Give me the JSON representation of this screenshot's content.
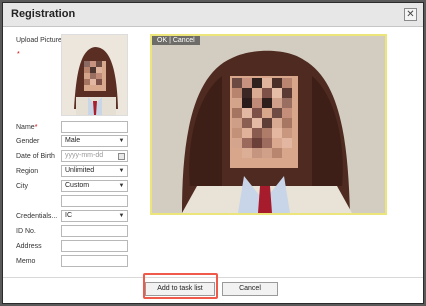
{
  "dialog": {
    "title": "Registration",
    "close_glyph": "✕"
  },
  "form": {
    "upload_label": "Upload Picture",
    "upload_required": "*",
    "fields": [
      {
        "label": "Name",
        "required": "*",
        "value": ""
      },
      {
        "label": "Gender",
        "value": "Male"
      },
      {
        "label": "Date of Birth",
        "placeholder": "yyyy-mm-dd"
      },
      {
        "label": "Region",
        "value": "Unlimited"
      },
      {
        "label": "City",
        "value": "Custom"
      },
      {
        "label": "",
        "value": ""
      },
      {
        "label": "Credentials...",
        "value": "IC"
      },
      {
        "label": "ID No.",
        "value": ""
      },
      {
        "label": "Address",
        "value": ""
      },
      {
        "label": "Memo",
        "value": ""
      }
    ]
  },
  "crop": {
    "ok": "OK",
    "separator": "|",
    "cancel": "Cancel"
  },
  "buttons": {
    "add_to_task_list": "Add to task list",
    "cancel": "Cancel"
  },
  "colors": {
    "highlight": "#f05a4a",
    "crop_border": "#ece57a"
  },
  "icons": {
    "close": "close-icon",
    "calendar": "calendar-icon",
    "dropdown": "chevron-down-icon"
  }
}
